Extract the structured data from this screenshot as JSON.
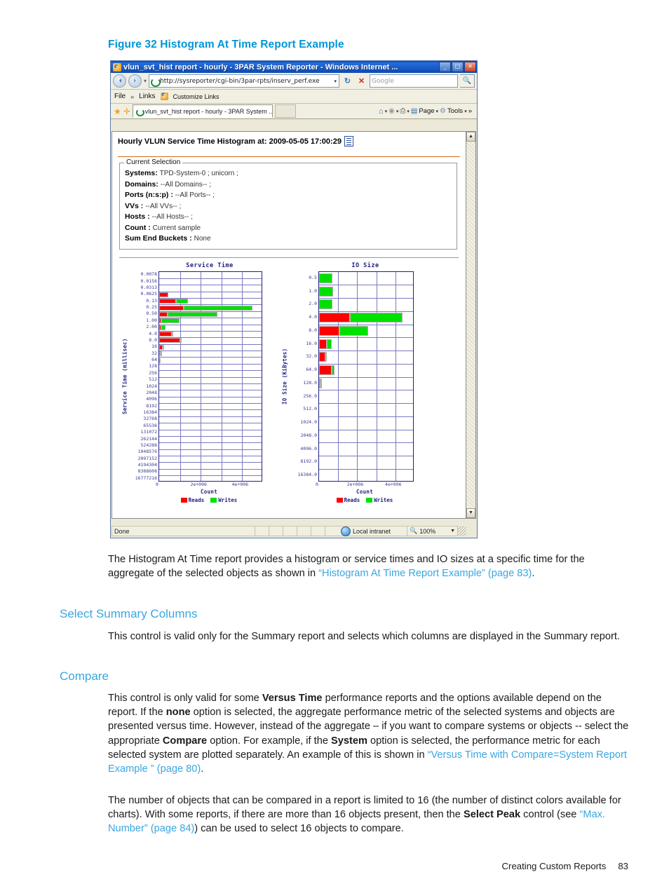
{
  "figure": {
    "caption": "Figure 32 Histogram At Time Report Example"
  },
  "browser": {
    "title": "vlun_svt_hist report - hourly - 3PAR System Reporter - Windows Internet ...",
    "window_buttons": {
      "minimize": "_",
      "maximize": "□",
      "close": "✕"
    },
    "address": {
      "url": "http://sysreporter/cgi-bin/3par-rpts/inserv_perf.exe",
      "dropdown": "▾"
    },
    "search": {
      "placeholder": "Google"
    },
    "menubar": {
      "file": "File",
      "chevron": "»",
      "links": "Links",
      "customize": "Customize Links"
    },
    "tab": {
      "label": "vlun_svt_hist report - hourly - 3PAR System ..."
    },
    "toolbar": {
      "home": "",
      "feeds": "",
      "print": "",
      "page": "Page",
      "tools": "Tools",
      "overflow": "»"
    },
    "status": {
      "done": "Done",
      "zone": "Local intranet",
      "zoom": "100%"
    }
  },
  "report": {
    "title": "Hourly VLUN Service Time Histogram at: 2009-05-05 17:00:29",
    "selection_legend": "Current Selection",
    "selection": [
      {
        "label": "Systems:",
        "value": "TPD-System-0 ; unicorn ;"
      },
      {
        "label": "Domains:",
        "value": "--All Domains-- ;"
      },
      {
        "label": "Ports (n:s:p) :",
        "value": "--All Ports-- ;"
      },
      {
        "label": "VVs :",
        "value": "--All VVs-- ;"
      },
      {
        "label": "Hosts :",
        "value": "--All Hosts-- ;"
      },
      {
        "label": "Count :",
        "value": "Current sample"
      },
      {
        "label": "Sum End Buckets :",
        "value": "None"
      }
    ]
  },
  "chart_data": [
    {
      "type": "bar",
      "orientation": "horizontal",
      "stacked": true,
      "title": "Service Time",
      "ylabel": "Service Time (millisec)",
      "xlabel": "Count",
      "xlim": [
        0,
        5000000
      ],
      "xticks": [
        "0",
        "2e+006",
        "4e+006"
      ],
      "xtick_values": [
        0,
        2000000,
        4000000
      ],
      "grid": true,
      "legend": [
        "Reads",
        "Writes"
      ],
      "legend_position": "bottom",
      "colors": {
        "reads": "#ff0000",
        "writes": "#00e000"
      },
      "categories": [
        "0.0078",
        "0.0156",
        "0.0313",
        "0.0625",
        "0.13",
        "0.25",
        "0.50",
        "1.00",
        "2.00",
        "4.0",
        "8.0",
        "16",
        "32",
        "64",
        "128",
        "256",
        "512",
        "1024",
        "2048",
        "4096",
        "8192",
        "16384",
        "32768",
        "65536",
        "131072",
        "262144",
        "524288",
        "1048576",
        "2097152",
        "4194304",
        "8388608",
        "16777216"
      ],
      "series": [
        {
          "name": "Reads",
          "values": [
            0,
            0,
            0,
            430000,
            810000,
            1180000,
            420000,
            110000,
            100000,
            620000,
            1000000,
            180000,
            80000,
            20000,
            0,
            0,
            0,
            0,
            0,
            0,
            0,
            0,
            0,
            0,
            0,
            0,
            0,
            0,
            0,
            0,
            0,
            0
          ]
        },
        {
          "name": "Writes",
          "values": [
            0,
            0,
            0,
            0,
            560000,
            3300000,
            2400000,
            880000,
            190000,
            60000,
            30000,
            20000,
            10000,
            0,
            0,
            0,
            0,
            0,
            0,
            0,
            0,
            0,
            0,
            0,
            0,
            0,
            0,
            0,
            0,
            0,
            0,
            0
          ]
        }
      ]
    },
    {
      "type": "bar",
      "orientation": "horizontal",
      "stacked": true,
      "title": "IO Size",
      "ylabel": "IO Size (KiBytes)",
      "xlabel": "Count",
      "xlim": [
        0,
        5000000
      ],
      "xticks": [
        "0",
        "2e+006",
        "4e+006"
      ],
      "xtick_values": [
        0,
        2000000,
        4000000
      ],
      "grid": true,
      "legend": [
        "Reads",
        "Writes"
      ],
      "legend_position": "bottom",
      "colors": {
        "reads": "#ff0000",
        "writes": "#00e000"
      },
      "categories": [
        "0.5",
        "1.0",
        "2.0",
        "4.0",
        "8.0",
        "16.0",
        "32.0",
        "64.0",
        "128.0",
        "256.0",
        "512.0",
        "1024.0",
        "2048.0",
        "4096.0",
        "8192.0",
        "16384.0"
      ],
      "series": [
        {
          "name": "Reads",
          "values": [
            0,
            0,
            0,
            1620000,
            1080000,
            390000,
            330000,
            680000,
            60000,
            0,
            0,
            0,
            0,
            0,
            0,
            0
          ]
        },
        {
          "name": "Writes",
          "values": [
            700000,
            720000,
            710000,
            2770000,
            1500000,
            290000,
            40000,
            120000,
            30000,
            0,
            0,
            0,
            0,
            0,
            0,
            0
          ]
        }
      ]
    }
  ],
  "body": {
    "para1_a": "The Histogram At Time report provides a histogram or service times and IO sizes at a specific time for the aggregate of the selected objects as shown in ",
    "para1_link1": "“Histogram At Time Report Example” (page 83)",
    "para1_b": ".",
    "section1_title": "Select Summary Columns",
    "para2": "This control is valid only for the Summary report and selects which columns are displayed in the Summary report.",
    "section2_title": "Compare",
    "para3_a": "This control is only valid for some ",
    "para3_b1": "Versus Time",
    "para3_c": " performance reports and the options available depend on the report. If the ",
    "para3_b2": "none",
    "para3_d": " option is selected, the aggregate performance metric of the selected systems and objects are presented versus time. However, instead of the aggregate – if you want to compare systems or objects -- select the appropriate ",
    "para3_b3": "Compare",
    "para3_e": " option. For example, if the ",
    "para3_b4": "System",
    "para3_f": " option is selected, the performance metric for each selected system are plotted separately. An example of this is shown in ",
    "para3_link": "“Versus Time with Compare=System Report Example ” (page 80)",
    "para3_g": ".",
    "para4_a": "The number of objects that can be compared in a report is limited to 16 (the number of distinct colors available for charts). With some reports, if there are more than 16 objects present, then the ",
    "para4_b1": "Select Peak",
    "para4_c": " control (see ",
    "para4_link": "“Max. Number” (page 84)",
    "para4_d": ") can be used to select 16 objects to compare."
  },
  "footer": {
    "chapter": "Creating Custom Reports",
    "page": "83"
  }
}
